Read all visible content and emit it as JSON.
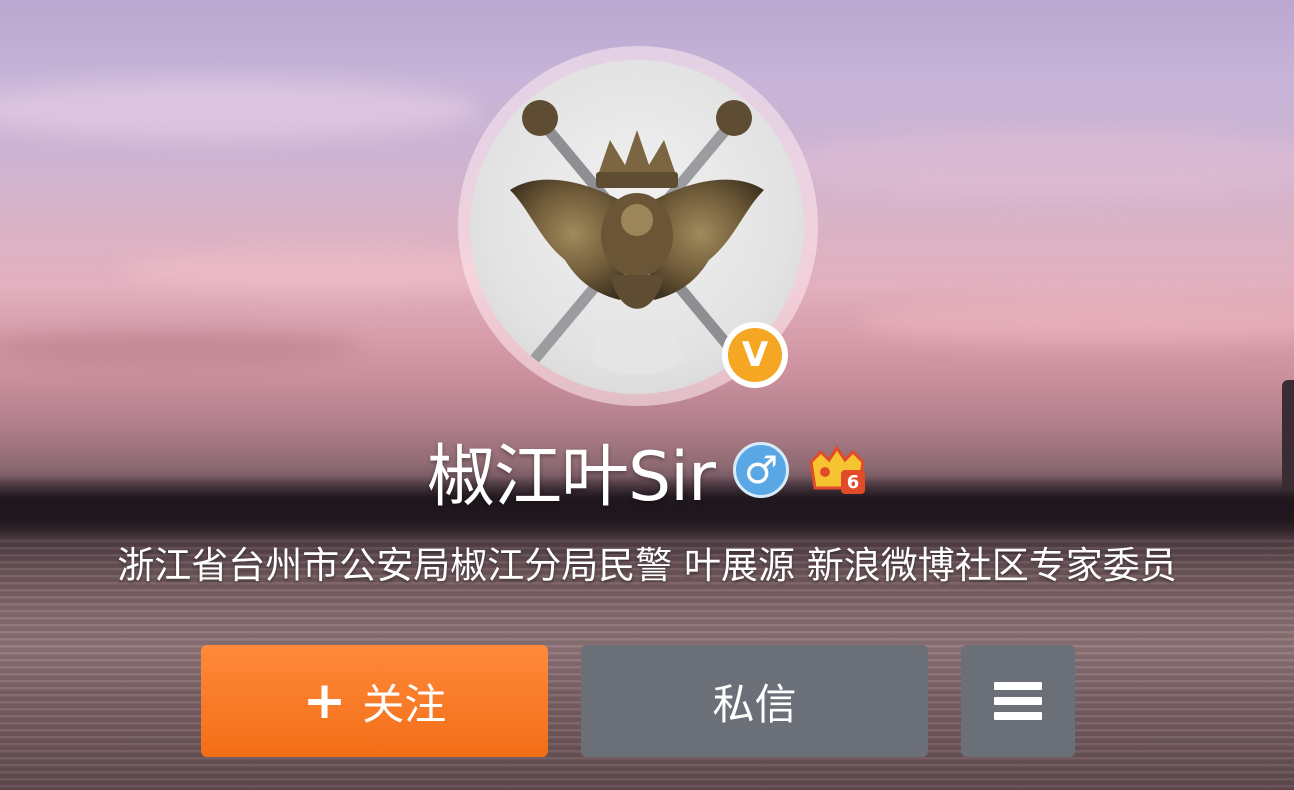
{
  "profile": {
    "username": "椒江叶Sir",
    "bio": "浙江省台州市公安局椒江分局民警 叶展源 新浪微博社区专家委员",
    "verified_badge_text": "V",
    "gender_symbol": "♂",
    "vip_level": "6"
  },
  "actions": {
    "follow_plus": "+",
    "follow_label": "关注",
    "message_label": "私信"
  },
  "colors": {
    "follow_button": "#f36d17",
    "secondary_button": "#6b6f78",
    "verified_badge": "#f5a623",
    "gender_badge": "#5aa7e6"
  },
  "icons": [
    "verified-icon",
    "male-gender-icon",
    "vip-crown-icon",
    "menu-icon",
    "plus-icon"
  ]
}
